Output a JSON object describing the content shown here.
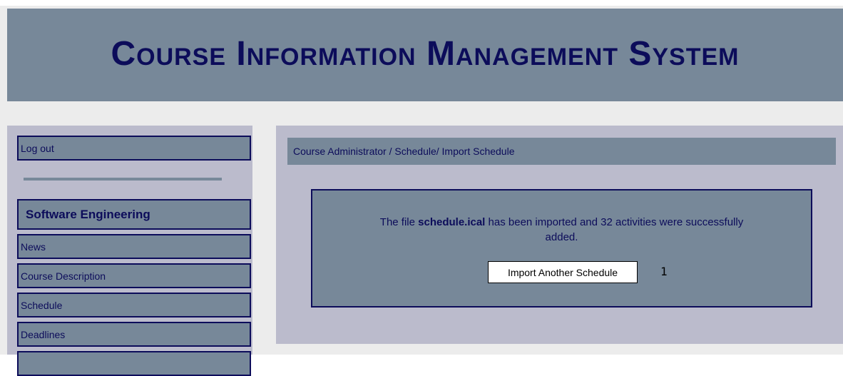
{
  "header": {
    "title": "Course Information Management System"
  },
  "sidebar": {
    "logout_label": "Log out",
    "course_title": "Software Engineering",
    "items": [
      {
        "label": "News"
      },
      {
        "label": "Course Description"
      },
      {
        "label": "Schedule"
      },
      {
        "label": "Deadlines"
      }
    ]
  },
  "main": {
    "breadcrumb": "Course Administrator / Schedule/ Import Schedule",
    "message": {
      "prefix": "The file ",
      "filename": "schedule.ical",
      "suffix_line1": " has been imported and 32 activities were successfully",
      "line2": "added."
    },
    "import_button_label": "Import Another Schedule",
    "marker": "1"
  },
  "colors": {
    "header_bg": "#778899",
    "panel_bg": "#bbbbcc",
    "text_navy": "#0c0c5a"
  }
}
